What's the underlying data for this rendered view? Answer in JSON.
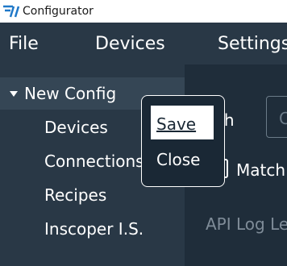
{
  "window": {
    "title": "Configurator"
  },
  "menu": {
    "file": "File",
    "devices": "Devices",
    "settings": "Settings"
  },
  "tree": {
    "root": "New Config",
    "children": [
      "Devices",
      "Connections",
      "Recipes",
      "Inscoper I.S."
    ]
  },
  "main": {
    "label_partial": "th",
    "input_partial": "C",
    "checkbox_label": "Match",
    "api_log_label": "API Log Le"
  },
  "context_menu": {
    "save": "Save",
    "close": "Close"
  }
}
